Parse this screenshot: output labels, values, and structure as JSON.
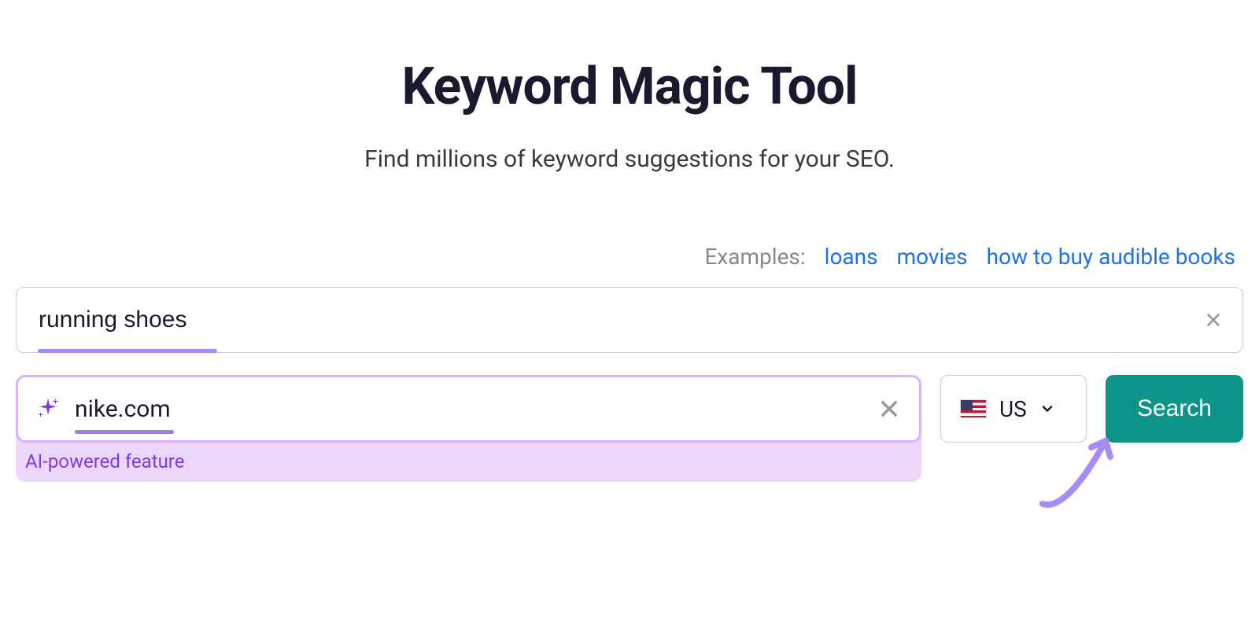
{
  "header": {
    "title": "Keyword Magic Tool",
    "subtitle": "Find millions of keyword suggestions for your SEO."
  },
  "examples": {
    "label": "Examples:",
    "links": [
      "loans",
      "movies",
      "how to buy audible books"
    ]
  },
  "keyword_input": {
    "value": "running shoes"
  },
  "domain_input": {
    "value": "nike.com",
    "ai_label": "AI-powered feature"
  },
  "country": {
    "code": "US"
  },
  "search": {
    "label": "Search"
  }
}
